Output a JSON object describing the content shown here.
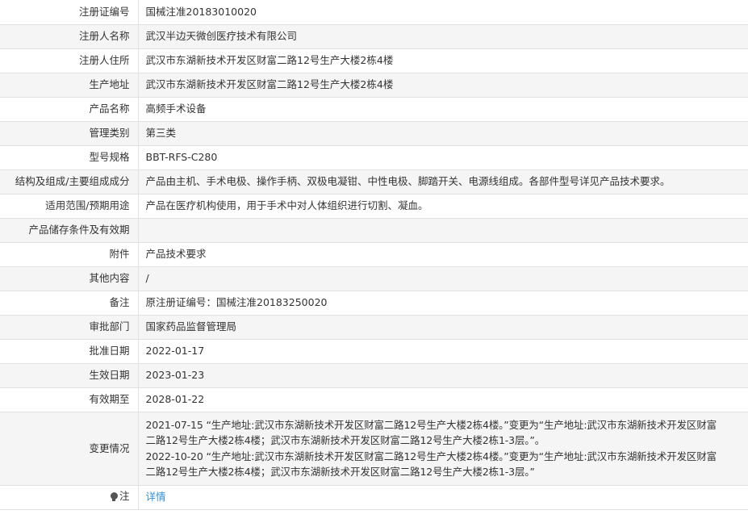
{
  "rows": [
    {
      "label": "注册证编号",
      "value": "国械注准20183010020"
    },
    {
      "label": "注册人名称",
      "value": "武汉半边天微创医疗技术有限公司"
    },
    {
      "label": "注册人住所",
      "value": "武汉市东湖新技术开发区财富二路12号生产大楼2栋4楼"
    },
    {
      "label": "生产地址",
      "value": "武汉市东湖新技术开发区财富二路12号生产大楼2栋4楼"
    },
    {
      "label": "产品名称",
      "value": "高频手术设备"
    },
    {
      "label": "管理类别",
      "value": "第三类"
    },
    {
      "label": "型号规格",
      "value": "BBT-RFS-C280"
    },
    {
      "label": "结构及组成/主要组成成分",
      "value": "产品由主机、手术电极、操作手柄、双极电凝钳、中性电极、脚踏开关、电源线组成。各部件型号详见产品技术要求。"
    },
    {
      "label": "适用范围/预期用途",
      "value": "产品在医疗机构使用，用于手术中对人体组织进行切割、凝血。"
    },
    {
      "label": "产品储存条件及有效期",
      "value": ""
    },
    {
      "label": "附件",
      "value": "产品技术要求"
    },
    {
      "label": "其他内容",
      "value": "/"
    },
    {
      "label": "备注",
      "value": "原注册证编号：国械注准20183250020"
    },
    {
      "label": "审批部门",
      "value": "国家药品监督管理局"
    },
    {
      "label": "批准日期",
      "value": "2022-01-17"
    },
    {
      "label": "生效日期",
      "value": "2023-01-23"
    },
    {
      "label": "有效期至",
      "value": "2028-01-22"
    }
  ],
  "changes": {
    "label": "变更情况",
    "lines": [
      "2021-07-15 “生产地址:武汉市东湖新技术开发区财富二路12号生产大楼2栋4楼。”变更为“生产地址:武汉市东湖新技术开发区财富",
      "二路12号生产大楼2栋4楼；武汉市东湖新技术开发区财富二路12号生产大楼2栋1-3层。”。",
      "2022-10-20 “生产地址:武汉市东湖新技术开发区财富二路12号生产大楼2栋4楼。”变更为“生产地址:武汉市东湖新技术开发区财富",
      "二路12号生产大楼2栋4楼；武汉市东湖新技术开发区财富二路12号生产大楼2栋1-3层。”"
    ]
  },
  "note": {
    "label": "注",
    "icon": "lightbulb-icon",
    "link_text": "详情",
    "link_color": "#2f8fd8"
  }
}
